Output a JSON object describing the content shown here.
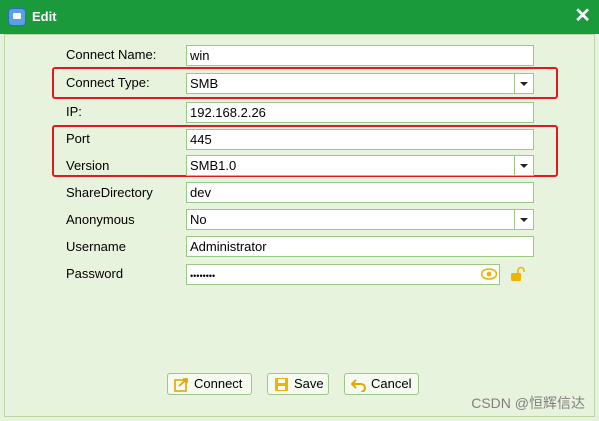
{
  "window": {
    "title": "Edit",
    "close_glyph": "✕"
  },
  "form": {
    "connect_name": {
      "label": "Connect Name:",
      "value": "win"
    },
    "connect_type": {
      "label": "Connect Type:",
      "value": "SMB"
    },
    "ip": {
      "label": "IP:",
      "value": "192.168.2.26"
    },
    "port": {
      "label": "Port",
      "value": "445"
    },
    "version": {
      "label": "Version",
      "value": "SMB1.0"
    },
    "share_directory": {
      "label": "ShareDirectory",
      "value": "dev"
    },
    "anonymous": {
      "label": "Anonymous",
      "value": "No"
    },
    "username": {
      "label": "Username",
      "value": "Administrator"
    },
    "password": {
      "label": "Password",
      "value": "••••••••"
    }
  },
  "buttons": {
    "connect": "Connect",
    "save": "Save",
    "cancel": "Cancel"
  },
  "watermark": "CSDN @恒辉信达",
  "colors": {
    "titlebar": "#1a9a3a",
    "highlight": "#e11b1b",
    "field_border": "#9dc689",
    "icon_yellow": "#f0b400"
  },
  "icons": {
    "app": "app-window-icon",
    "eye": "eye-icon",
    "lock": "unlock-icon",
    "connect": "connect-icon",
    "save": "save-icon",
    "cancel": "cancel-icon"
  }
}
